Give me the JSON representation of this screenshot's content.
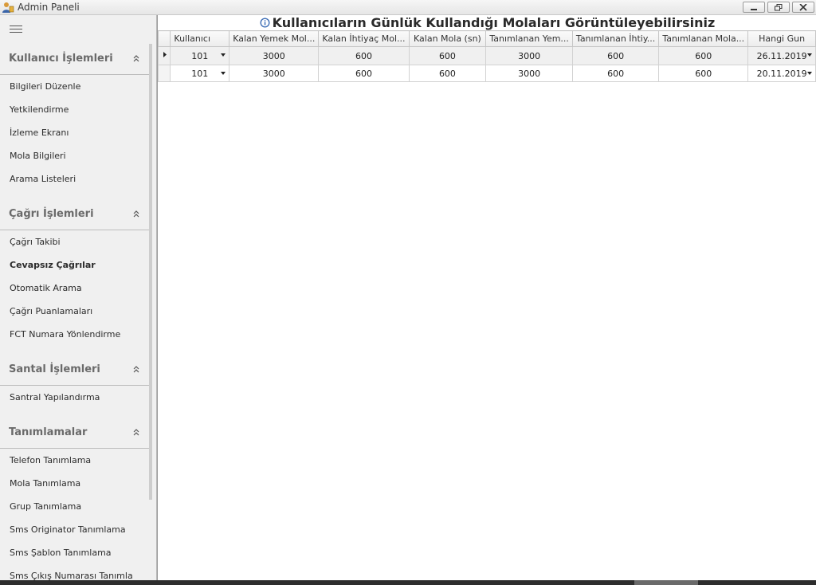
{
  "window": {
    "title": "Admin Paneli"
  },
  "panel": {
    "title": "Kullanıcıların Günlük Kullandığı Molaları Görüntüleyebilirsiniz"
  },
  "sidebar": {
    "groups": [
      {
        "title": "Kullanıcı İşlemleri",
        "items": [
          "Bilgileri Düzenle",
          "Yetkilendirme",
          "İzleme Ekranı",
          "Mola Bilgileri",
          "Arama Listeleri"
        ]
      },
      {
        "title": "Çağrı İşlemleri",
        "items": [
          "Çağrı Takibi",
          "Cevapsız Çağrılar",
          "Otomatik Arama",
          "Çağrı Puanlamaları",
          "FCT Numara Yönlendirme"
        ]
      },
      {
        "title": "Santal İşlemleri",
        "items": [
          "Santral Yapılandırma"
        ]
      },
      {
        "title": "Tanımlamalar",
        "items": [
          "Telefon Tanımlama",
          "Mola Tanımlama",
          "Grup Tanımlama",
          "Sms Originator Tanımlama",
          "Sms Şablon Tanımlama",
          "Sms Çıkış Numarası Tanımla"
        ]
      }
    ]
  },
  "grid": {
    "columns": [
      "Kullanıcı",
      "Kalan Yemek Mol...",
      "Kalan İhtiyaç Mol...",
      "Kalan Mola (sn)",
      "Tanımlanan Yem...",
      "Tanımlanan İhtiy...",
      "Tanımlanan Mola...",
      "Hangi Gun"
    ],
    "rows": [
      [
        "101",
        "3000",
        "600",
        "600",
        "3000",
        "600",
        "600",
        "26.11.2019"
      ],
      [
        "101",
        "3000",
        "600",
        "600",
        "3000",
        "600",
        "600",
        "20.11.2019"
      ]
    ]
  },
  "colors": {
    "window_bg": "#f0f0f0",
    "grid_border": "#c6c6c6",
    "group_title": "#6a6a6a"
  }
}
